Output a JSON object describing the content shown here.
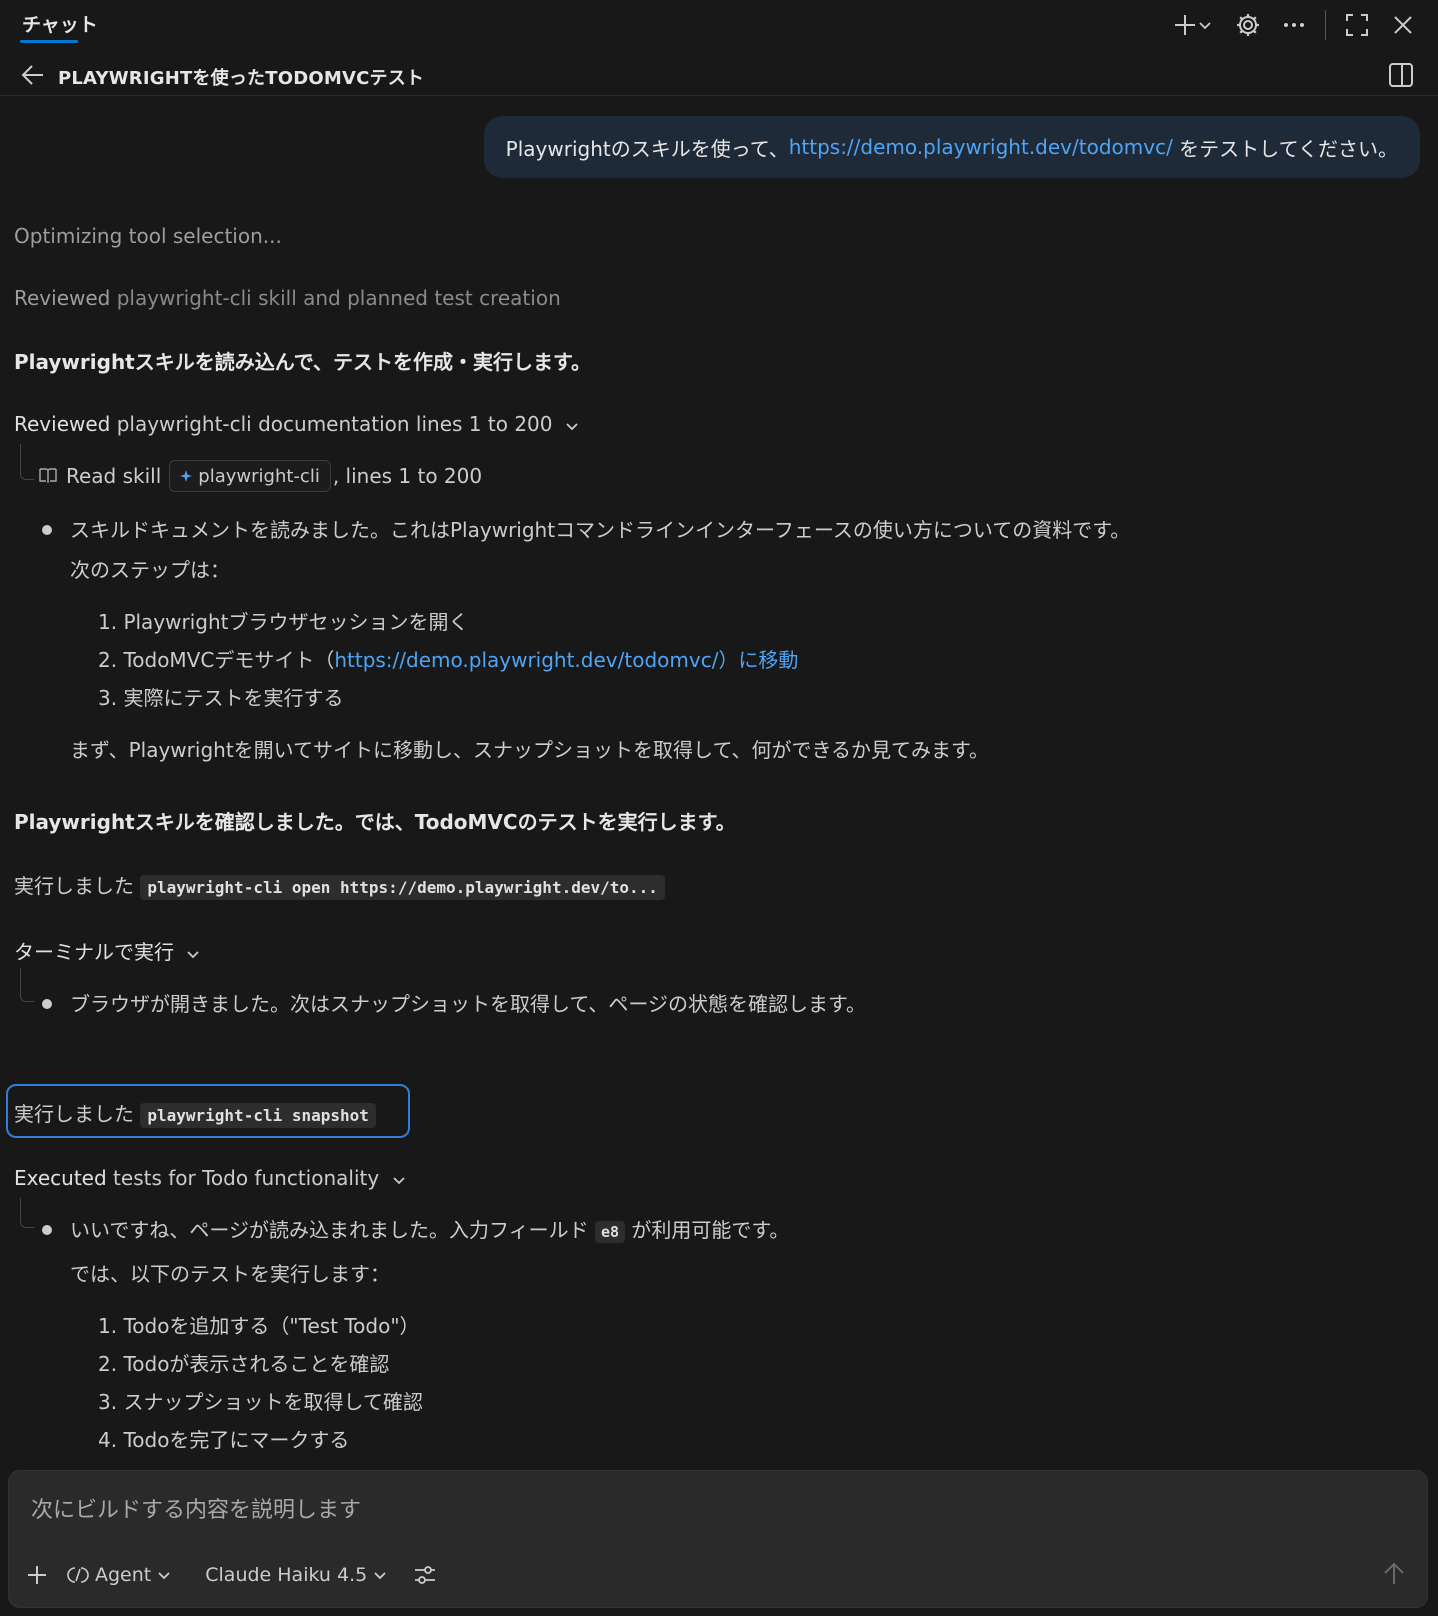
{
  "topbar": {
    "tab_label": "チャット"
  },
  "header": {
    "title": "PLAYWRIGHTを使ったTODOMVCテスト"
  },
  "user_message": {
    "prefix": "Playwrightのスキルを使って、",
    "link": "https://demo.playwright.dev/todomvc/",
    "suffix": " をテストしてください。"
  },
  "status": {
    "optimizing": "Optimizing tool selection...",
    "reviewed_prefix": "Reviewed",
    "reviewed_text": " playwright-cli skill and planned test creation"
  },
  "response": {
    "heading1": "Playwrightスキルを読み込んで、テストを作成・実行します。",
    "section1": {
      "prefix": "Reviewed",
      "text": " playwright-cli documentation lines 1 to 200",
      "read_skill": "Read skill",
      "skill_chip": "playwright-cli",
      "lines": ", lines 1 to 200",
      "bullet": "スキルドキュメントを読みました。これはPlaywrightコマンドラインインターフェースの使い方についての資料です。",
      "next_steps": "次のステップは：",
      "steps": [
        "1. Playwrightブラウザセッションを開く",
        "2. TodoMVCデモサイト（",
        "3. 実際にテストを実行する"
      ],
      "step2_link": "https://demo.playwright.dev/todomvc/）に移動",
      "closing": "まず、Playwrightを開いてサイトに移動し、スナップショットを取得して、何ができるか見てみます。"
    },
    "heading2": "Playwrightスキルを確認しました。では、TodoMVCのテストを実行します。",
    "exec1_label": "実行しました",
    "exec1_code": "playwright-cli open https://demo.playwright.dev/to...",
    "terminal_label": "ターミナルで実行",
    "terminal_bullet": "ブラウザが開きました。次はスナップショットを取得して、ページの状態を確認します。",
    "exec2_label": "実行しました",
    "exec2_code": "playwright-cli snapshot",
    "section2": {
      "prefix": "Executed",
      "text": " tests for Todo functionality",
      "bullet_pre": "いいですね、ページが読み込まれました。入力フィールド",
      "bullet_code": "e8",
      "bullet_post": "が利用可能です。",
      "intro": "では、以下のテストを実行します：",
      "tests": [
        "1. Todoを追加する（\"Test Todo\"）",
        "2. Todoが表示されることを確認",
        "3. スナップショットを取得して確認",
        "4. Todoを完了にマークする"
      ]
    }
  },
  "composer": {
    "placeholder": "次にビルドする内容を説明します",
    "agent_label": "Agent",
    "model_label": "Claude Haiku 4.5"
  },
  "colors": {
    "background": "#181818",
    "accent": "#0078d4",
    "link": "#4ea4f5",
    "user_bubble": "#1f2a38"
  }
}
